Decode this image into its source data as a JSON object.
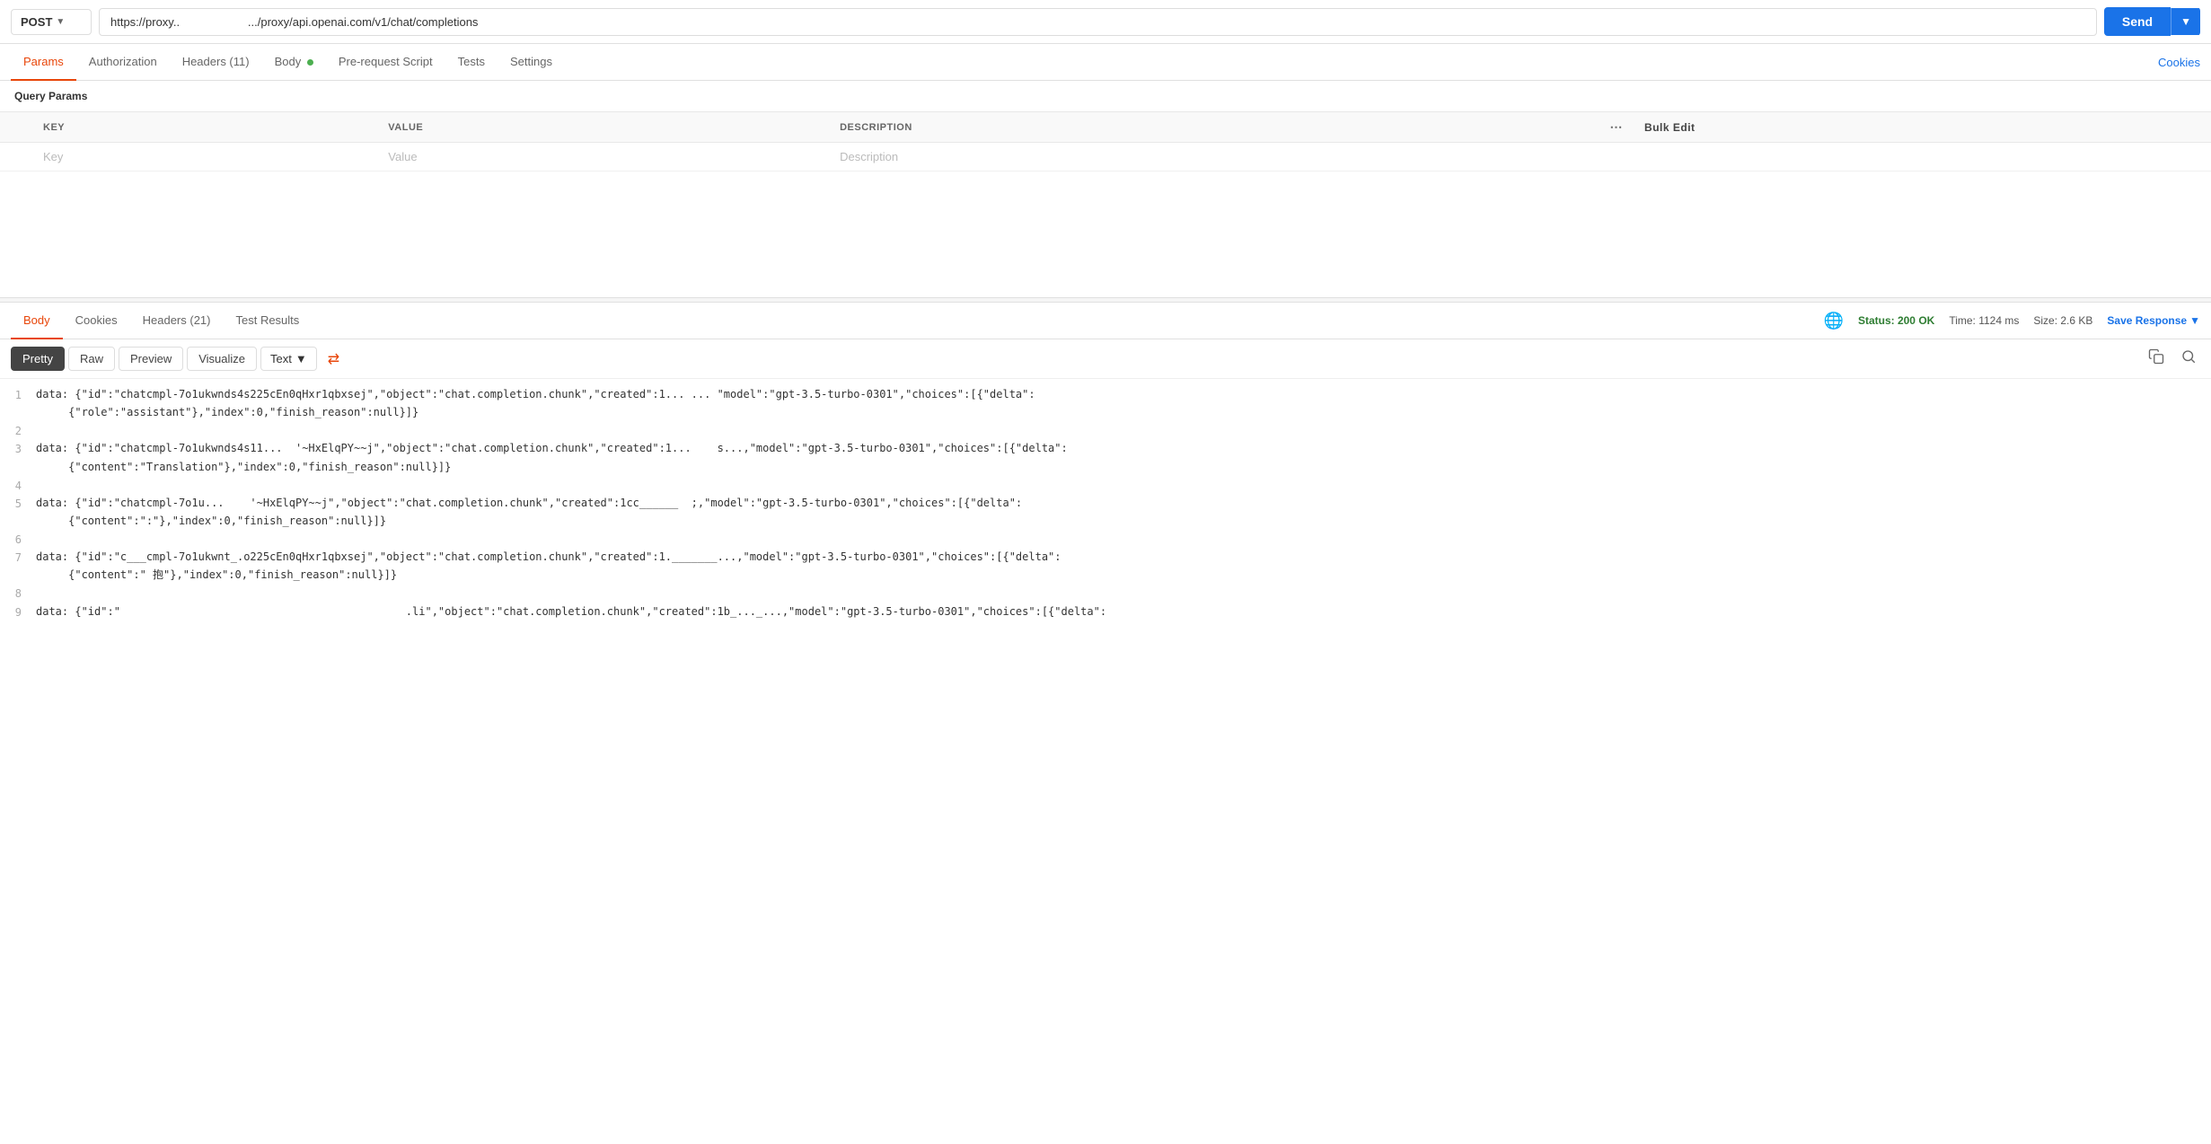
{
  "topbar": {
    "method": "POST",
    "url": "https://proxy..                     .../proxy/api.openai.com/v1/chat/completions",
    "send_label": "Send"
  },
  "request_tabs": [
    {
      "id": "params",
      "label": "Params",
      "active": true
    },
    {
      "id": "authorization",
      "label": "Authorization",
      "active": false
    },
    {
      "id": "headers",
      "label": "Headers (11)",
      "active": false
    },
    {
      "id": "body",
      "label": "Body",
      "active": false,
      "dot": true
    },
    {
      "id": "prerequest",
      "label": "Pre-request Script",
      "active": false
    },
    {
      "id": "tests",
      "label": "Tests",
      "active": false
    },
    {
      "id": "settings",
      "label": "Settings",
      "active": false
    }
  ],
  "cookies_label": "Cookies",
  "query_params_label": "Query Params",
  "table": {
    "columns": [
      "KEY",
      "VALUE",
      "DESCRIPTION",
      "...",
      "Bulk Edit"
    ],
    "key_placeholder": "Key",
    "value_placeholder": "Value",
    "description_placeholder": "Description"
  },
  "response_tabs": [
    {
      "id": "body",
      "label": "Body",
      "active": true
    },
    {
      "id": "cookies",
      "label": "Cookies",
      "active": false
    },
    {
      "id": "headers",
      "label": "Headers (21)",
      "active": false
    },
    {
      "id": "test_results",
      "label": "Test Results",
      "active": false
    }
  ],
  "response_status": {
    "status": "Status: 200 OK",
    "time": "Time: 1124 ms",
    "size": "Size: 2.6 KB",
    "save_label": "Save Response"
  },
  "format_bar": {
    "pretty_label": "Pretty",
    "raw_label": "Raw",
    "preview_label": "Preview",
    "visualize_label": "Visualize",
    "format_type": "Text"
  },
  "code_lines": [
    {
      "num": "1",
      "content": "data: {\"id\":\"chatcmpl-7o1ukwnds4s225cEn0qHxr1qbxsej\",\"object\":\"chat.completion.chunk\",\"created\":1... ... \"model\":\"gpt-3.5-turbo-0301\",\"choices\":[{\"delta\":"
    },
    {
      "num": "",
      "content": "     {\"role\":\"assistant\"},\"index\":0,\"finish_reason\":null}]}"
    },
    {
      "num": "2",
      "content": ""
    },
    {
      "num": "3",
      "content": "data: {\"id\":\"chatcmpl-7o1ukwnds4s11...  '~HxElqPY~~j\",\"object\":\"chat.completion.chunk\",\"created\":1...    s...,\"model\":\"gpt-3.5-turbo-0301\",\"choices\":[{\"delta\":"
    },
    {
      "num": "",
      "content": "     {\"content\":\"Translation\"},\"index\":0,\"finish_reason\":null}]}"
    },
    {
      "num": "4",
      "content": ""
    },
    {
      "num": "5",
      "content": "data: {\"id\":\"chatcmpl-7o1u...    '~HxElqPY~~j\",\"object\":\"chat.completion.chunk\",\"created\":1cc______  ;,\"model\":\"gpt-3.5-turbo-0301\",\"choices\":[{\"delta\":"
    },
    {
      "num": "",
      "content": "     {\"content\":\":\"},\"index\":0,\"finish_reason\":null}]}"
    },
    {
      "num": "6",
      "content": ""
    },
    {
      "num": "7",
      "content": "data: {\"id\":\"c___cmpl-7o1ukwnt_.o225cEn0qHxr1qbxsej\",\"object\":\"chat.completion.chunk\",\"created\":1._______...,\"model\":\"gpt-3.5-turbo-0301\",\"choices\":[{\"delta\":"
    },
    {
      "num": "",
      "content": "     {\"content\":\" 抱\"},\"index\":0,\"finish_reason\":null}]}"
    },
    {
      "num": "8",
      "content": ""
    },
    {
      "num": "9",
      "content": "data: {\"id\":\"                                            .li\",\"object\":\"chat.completion.chunk\",\"created\":1b_..._...,\"model\":\"gpt-3.5-turbo-0301\",\"choices\":[{\"delta\":"
    }
  ]
}
